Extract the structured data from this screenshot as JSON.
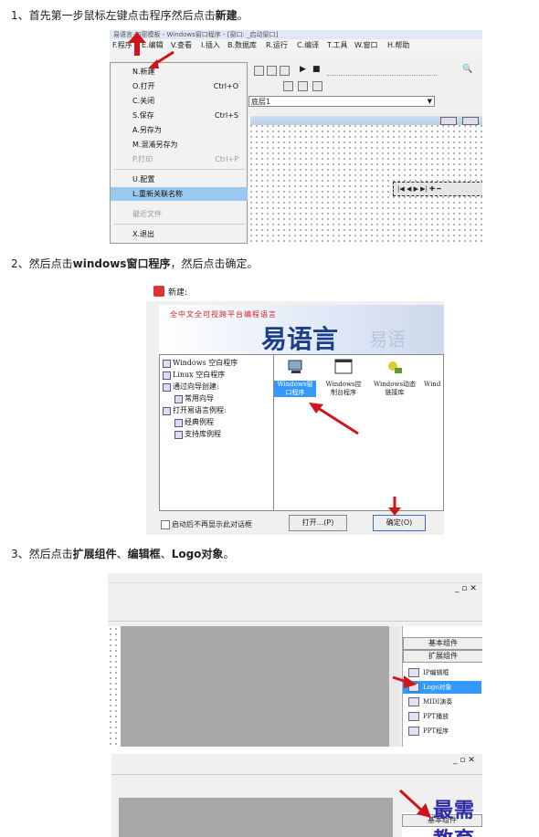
{
  "steps": [
    {
      "prefix": "1、首先第一步鼠标左键点击程序然后点击",
      "bold": "新建",
      "suffix": "。"
    },
    {
      "prefix": "2、然后点击",
      "bold": "windows窗口程序",
      "suffix": "，然后点击确定。"
    },
    {
      "prefix": "3、然后点击",
      "bold": "扩展组件",
      "mid1": "、",
      "bold2": "编辑框",
      "mid2": "、",
      "bold3": "Logo对象",
      "suffix": "。"
    }
  ],
  "shot1": {
    "title": "易语言-加密模板 - Windows窗口程序 - [窗口: _启动窗口]",
    "menubar": [
      "F.程序",
      "E.编辑",
      "V.查看",
      "I.插入",
      "B.数据库",
      "R.运行",
      "C.编译",
      "T.工具",
      "W.窗口",
      "H.帮助"
    ],
    "menu": [
      {
        "label": "N.新建",
        "shortcut": "",
        "disabled": false
      },
      {
        "label": "O.打开",
        "shortcut": "Ctrl+O",
        "disabled": false
      },
      {
        "label": "C.关闭",
        "shortcut": "",
        "disabled": false
      },
      {
        "label": "S.保存",
        "shortcut": "Ctrl+S",
        "disabled": false
      },
      {
        "label": "A.另存为",
        "shortcut": "",
        "disabled": false
      },
      {
        "label": "M.混淆另存为",
        "shortcut": "",
        "disabled": false
      },
      {
        "label": "P.打印",
        "shortcut": "Ctrl+P",
        "disabled": true
      },
      {
        "label": "U.配置",
        "shortcut": "",
        "disabled": false
      },
      {
        "label": "L.重新关联名称",
        "shortcut": "",
        "disabled": false
      },
      {
        "label": "最近文件",
        "shortcut": "",
        "disabled": true
      },
      {
        "label": "X.退出",
        "shortcut": "",
        "disabled": false
      }
    ],
    "combo_value": "底层1"
  },
  "shot2": {
    "dialog_title": "新建:",
    "banner_sub": "全中文全可视跨平台编程语言",
    "banner_title": "易语言",
    "tree": [
      "Windows 空白程序",
      "Linux 空白程序",
      "通过向导创建:",
      "常用向导",
      "打开易语言例程:",
      "经典例程",
      "支持库例程"
    ],
    "templates": [
      "Windows窗口程序",
      "Windows控制台程序",
      "Windows动态链接库",
      "Wind"
    ],
    "checkbox_label": "启动后不再显示此对话框",
    "open_button": "打开...(P)",
    "ok_button": "确定(O)"
  },
  "shot3": {
    "tab_basic": "基本组件",
    "tab_ext": "扩展组件",
    "components": [
      "IP编辑框",
      "Logo对象",
      "MIDI演奏",
      "PPT播放",
      "PPT程序"
    ],
    "window_controls": [
      "_",
      "▫",
      "×"
    ]
  },
  "shot4": {
    "tab_basic": "基本组件",
    "watermark": "最需教育"
  },
  "colors": {
    "arrow": "#d0141c",
    "highlight": "#3399ff",
    "menu_selected": "#99c9ef",
    "banner_bg": "#e8eef8",
    "watermark": "#2d2aa6"
  }
}
